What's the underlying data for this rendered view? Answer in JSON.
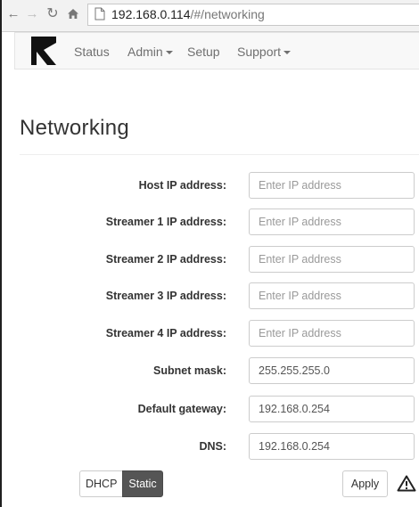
{
  "browser": {
    "url_host": "192.168.0.114",
    "url_path": "/#/networking"
  },
  "navbar": {
    "items": [
      {
        "label": "Status",
        "has_caret": false
      },
      {
        "label": "Admin",
        "has_caret": true
      },
      {
        "label": "Setup",
        "has_caret": false
      },
      {
        "label": "Support",
        "has_caret": true
      }
    ]
  },
  "page": {
    "title": "Networking"
  },
  "form": {
    "fields": [
      {
        "label": "Host IP address:",
        "value": "",
        "placeholder": "Enter IP address"
      },
      {
        "label": "Streamer 1 IP address:",
        "value": "",
        "placeholder": "Enter IP address"
      },
      {
        "label": "Streamer 2 IP address:",
        "value": "",
        "placeholder": "Enter IP address"
      },
      {
        "label": "Streamer 3 IP address:",
        "value": "",
        "placeholder": "Enter IP address"
      },
      {
        "label": "Streamer 4 IP address:",
        "value": "",
        "placeholder": "Enter IP address"
      },
      {
        "label": "Subnet mask:",
        "value": "255.255.255.0",
        "placeholder": ""
      },
      {
        "label": "Default gateway:",
        "value": "192.168.0.254",
        "placeholder": ""
      },
      {
        "label": "DNS:",
        "value": "192.168.0.254",
        "placeholder": ""
      }
    ]
  },
  "controls": {
    "mode_options": [
      "DHCP",
      "Static"
    ],
    "selected_mode": "Static",
    "apply_label": "Apply"
  },
  "icons": {
    "back": "back-arrow-icon",
    "forward": "forward-arrow-icon",
    "reload": "reload-icon",
    "home": "home-icon",
    "page": "page-icon",
    "logo": "brand-logo",
    "warning": "warning-icon"
  },
  "colors": {
    "active_toggle": "#555555",
    "navbar_bg": "#f8f8f8"
  }
}
